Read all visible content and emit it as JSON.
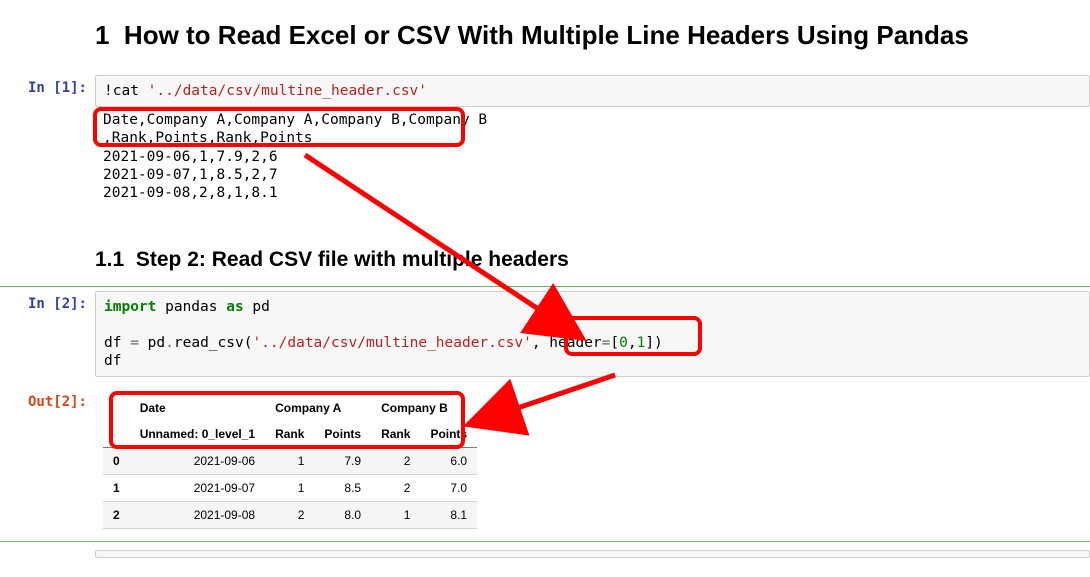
{
  "title_prefix": "1",
  "title": "How to Read Excel or CSV With Multiple Line Headers Using Pandas",
  "subtitle_prefix": "1.1",
  "subtitle": "Step 2: Read CSV file with multiple headers",
  "prompts": {
    "in1": "In [1]:",
    "in2": "In [2]:",
    "out2": "Out[2]:"
  },
  "code1": {
    "bang": "!cat ",
    "str": "'../data/csv/multine_header.csv'"
  },
  "output1": {
    "l1": "Date,Company A,Company A,Company B,Company B",
    "l2": ",Rank,Points,Rank,Points",
    "l3": "2021-09-06,1,7.9,2,6",
    "l4": "2021-09-07,1,8.5,2,7",
    "l5": "2021-09-08,2,8,1,8.1"
  },
  "code2": {
    "import": "import",
    "pandas": " pandas ",
    "as": "as",
    "pd": " pd",
    "line2_a": "df ",
    "eq": "=",
    "line2_b": " pd",
    "dot": ".",
    "read": "read_csv(",
    "str": "'../data/csv/multine_header.csv'",
    "comma": ", header",
    "eq2": "=",
    "brk1": "[",
    "n0": "0",
    "comma2": ",",
    "n1": "1",
    "brk2": "])",
    "line3": "df"
  },
  "df": {
    "head_top": [
      "",
      "Date",
      "Company A",
      "Company A",
      "Company B",
      "Company B"
    ],
    "head_bot": [
      "",
      "Unnamed: 0_level_1",
      "Rank",
      "Points",
      "Rank",
      "Points"
    ],
    "rows": [
      {
        "idx": "0",
        "date": "2021-09-06",
        "rA": "1",
        "pA": "7.9",
        "rB": "2",
        "pB": "6.0"
      },
      {
        "idx": "1",
        "date": "2021-09-07",
        "rA": "1",
        "pA": "8.5",
        "rB": "2",
        "pB": "7.0"
      },
      {
        "idx": "2",
        "date": "2021-09-08",
        "rA": "2",
        "pA": "8.0",
        "rB": "1",
        "pB": "8.1"
      }
    ]
  },
  "chart_data": {
    "type": "table",
    "columns_level0": [
      "Date",
      "Company A",
      "Company A",
      "Company B",
      "Company B"
    ],
    "columns_level1": [
      "Unnamed: 0_level_1",
      "Rank",
      "Points",
      "Rank",
      "Points"
    ],
    "index": [
      0,
      1,
      2
    ],
    "data": [
      [
        "2021-09-06",
        1,
        7.9,
        2,
        6.0
      ],
      [
        "2021-09-07",
        1,
        8.5,
        2,
        7.0
      ],
      [
        "2021-09-08",
        2,
        8.0,
        1,
        8.1
      ]
    ]
  }
}
